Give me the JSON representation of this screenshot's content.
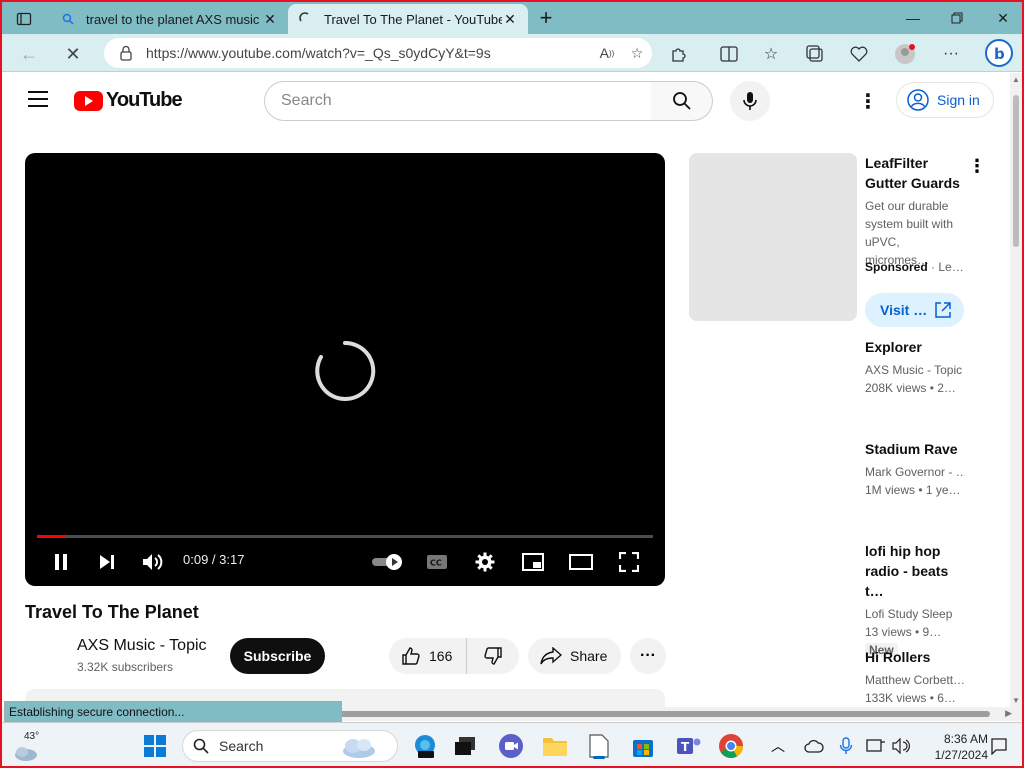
{
  "browser": {
    "tabs": [
      {
        "title": "travel to the planet AXS music -",
        "active": false
      },
      {
        "title": "Travel To The Planet - YouTube",
        "active": true
      }
    ],
    "url": "https://www.youtube.com/watch?v=_Qs_s0ydCyY&t=9s",
    "status_text": "Establishing secure connection...",
    "colors": {
      "tabbar": "#7fbcc4",
      "toolbar": "#d8eef0",
      "frame": "#e81123"
    }
  },
  "youtube": {
    "logo_text": "YouTube",
    "search_placeholder": "Search",
    "sign_in_label": "Sign in",
    "player": {
      "current_time": "0:09",
      "duration": "3:17",
      "time_display": "0:09 / 3:17",
      "progress_fraction": 0.046
    },
    "video": {
      "title": "Travel To The Planet",
      "channel": "AXS Music - Topic",
      "subscribers": "3.32K subscribers",
      "subscribe_label": "Subscribe",
      "likes": "166",
      "share_label": "Share"
    },
    "ad": {
      "title": "LeafFilter Gutter Guards",
      "description": "Get our durable system built with uPVC, micromes…",
      "sponsored": "Sponsored",
      "advertiser": "Le…",
      "visit_label": "Visit …"
    },
    "recommendations": [
      {
        "title": "Explorer",
        "channel": "AXS Music - Topic",
        "meta": "208K views • 2…",
        "badge": ""
      },
      {
        "title": "Stadium Rave",
        "channel": "Mark Governor - …",
        "meta": "1M views • 1 ye…",
        "badge": ""
      },
      {
        "title": "lofi hip hop radio - beats t…",
        "channel": "Lofi Study Sleep",
        "meta": "13 views • 9…",
        "badge": "New"
      },
      {
        "title": "Hi Rollers",
        "channel": "Matthew Corbett…",
        "meta": "133K views • 6…",
        "badge": ""
      }
    ],
    "colors": {
      "brand_red": "#ff0000",
      "link_blue": "#065fd4"
    }
  },
  "taskbar": {
    "temperature": "43°",
    "search_label": "Search",
    "time": "8:36 AM",
    "date": "1/27/2024"
  }
}
